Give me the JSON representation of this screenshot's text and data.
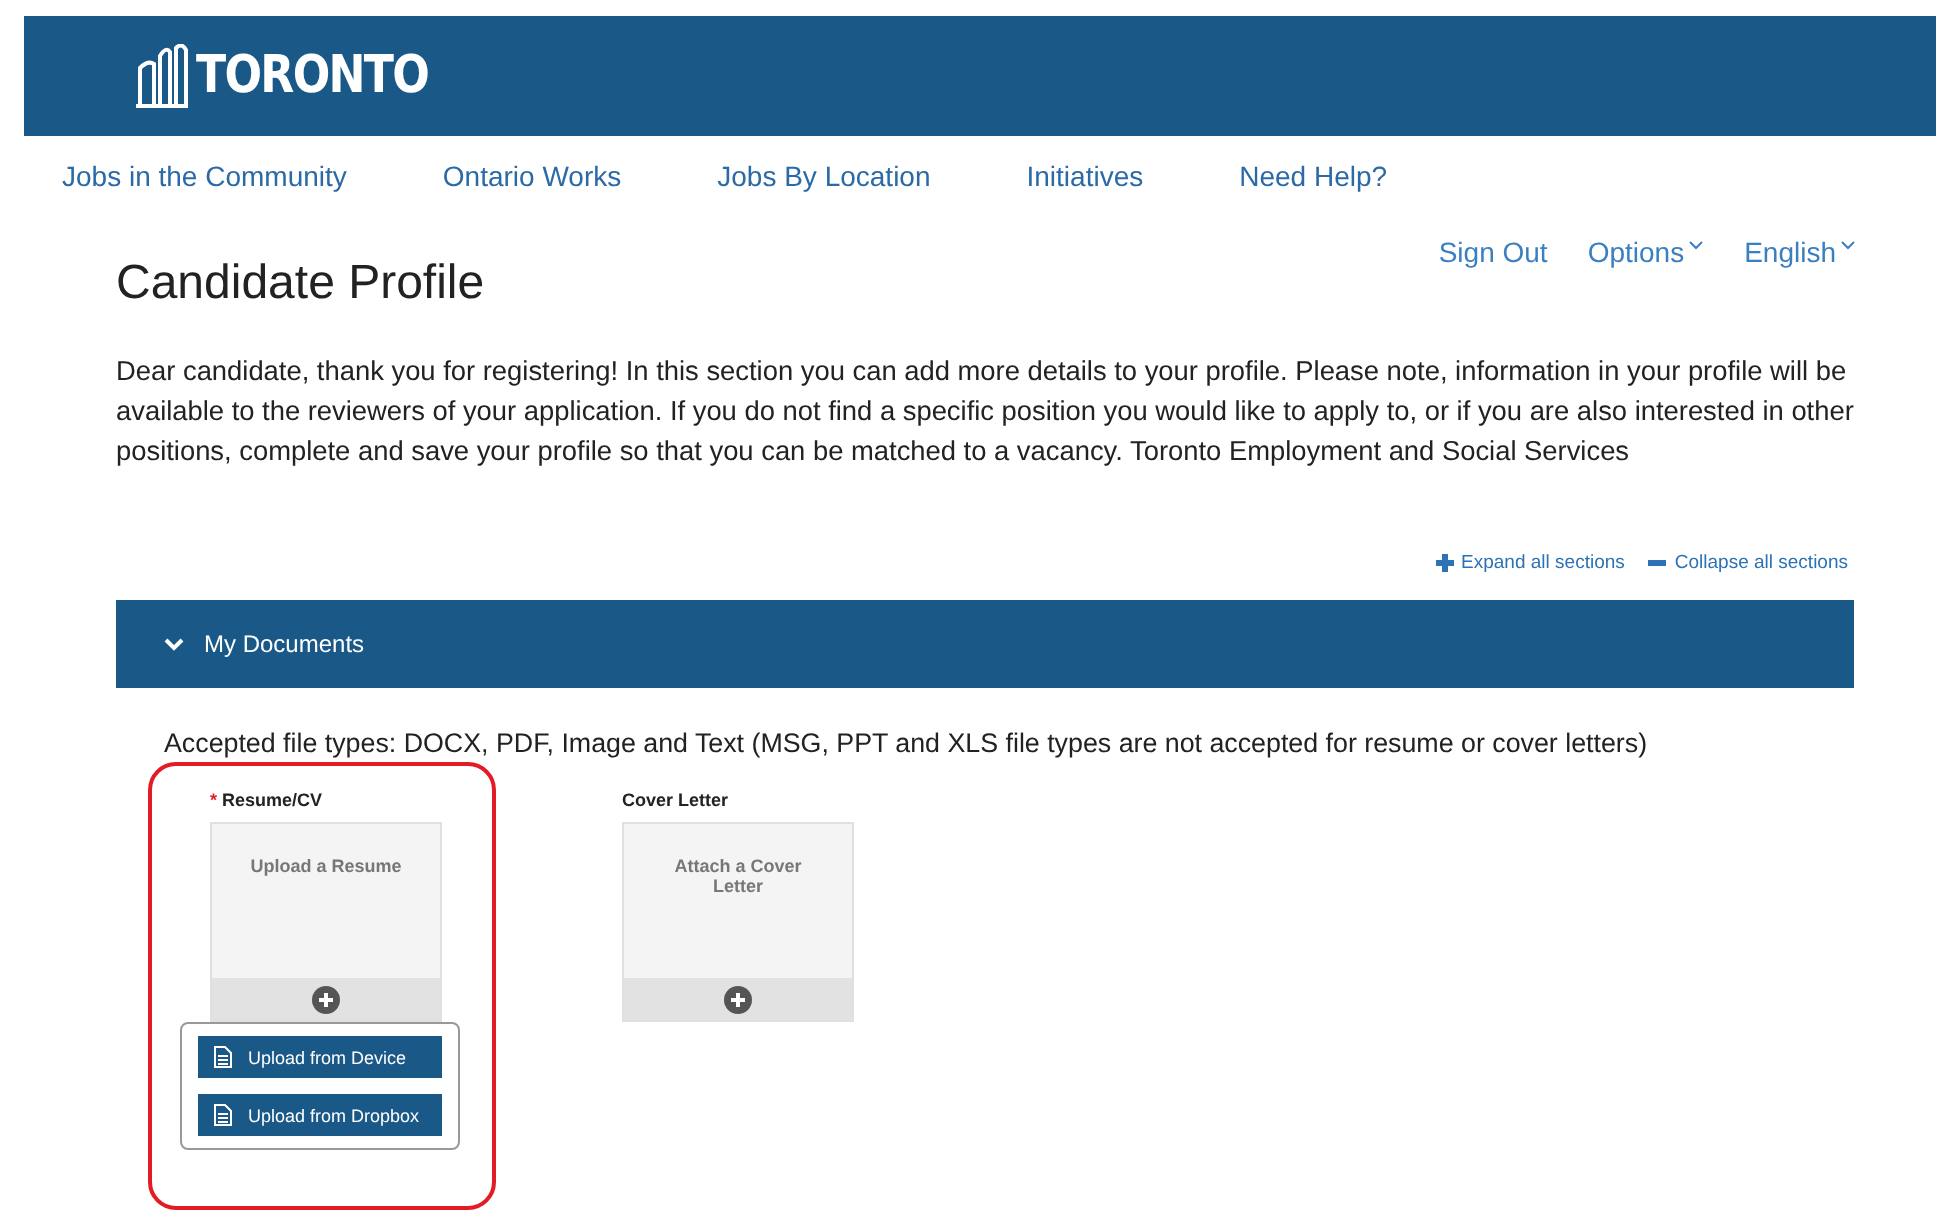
{
  "header": {
    "logo_text": "TORONTO"
  },
  "nav": [
    {
      "label": "Jobs in the Community"
    },
    {
      "label": "Ontario Works"
    },
    {
      "label": "Jobs By Location"
    },
    {
      "label": "Initiatives"
    },
    {
      "label": "Need Help?"
    }
  ],
  "user_menu": [
    {
      "label": "Sign Out",
      "dropdown": false
    },
    {
      "label": "Options",
      "dropdown": true
    },
    {
      "label": "English",
      "dropdown": true
    }
  ],
  "page_title": "Candidate Profile",
  "intro": "Dear candidate, thank you for registering! In this section you can add more details to your profile. Please note, information in your profile will be available to the reviewers of your application. If you do not find a specific position you would like to apply to, or if you are also interested in other positions, complete and save your profile so that you can be matched to a vacancy. Toronto Employment and Social Services",
  "section_actions": [
    {
      "kind": "expand",
      "label": "Expand all sections"
    },
    {
      "kind": "collapse",
      "label": "Collapse all sections"
    }
  ],
  "section": {
    "title": "My Documents",
    "expanded": true,
    "note": "Accepted file types: DOCX, PDF, Image and Text (MSG, PPT and XLS file types are not accepted for resume or cover letters)",
    "documents": [
      {
        "label": "Resume/CV",
        "required_mark": "*",
        "highlighted": true,
        "prompt": "Upload a Resume",
        "menu": [
          {
            "label": "Upload from Device"
          },
          {
            "label": "Upload from Dropbox"
          }
        ]
      },
      {
        "label": "Cover Letter",
        "prompt": "Attach a Cover Letter"
      }
    ]
  }
}
